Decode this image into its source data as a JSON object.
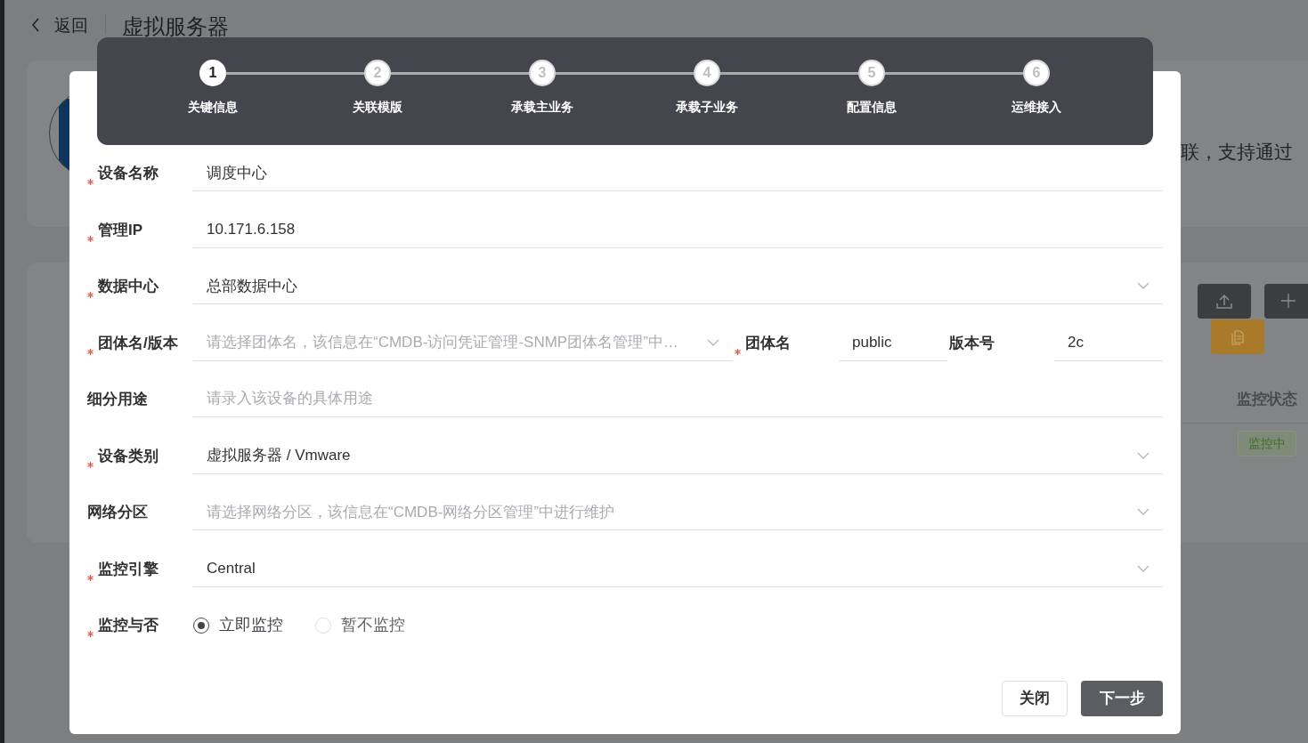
{
  "page": {
    "back": "返回",
    "title": "虚拟服务器",
    "description_fragment": "联，支持通过",
    "table_header": "监控状态",
    "status_tag": "监控中"
  },
  "steps": [
    {
      "number": "1",
      "label": "关键信息",
      "selected": true
    },
    {
      "number": "2",
      "label": "关联模版",
      "selected": false
    },
    {
      "number": "3",
      "label": "承载主业务",
      "selected": false
    },
    {
      "number": "4",
      "label": "承载子业务",
      "selected": false
    },
    {
      "number": "5",
      "label": "配置信息",
      "selected": false
    },
    {
      "number": "6",
      "label": "运维接入",
      "selected": false
    }
  ],
  "fields": [
    {
      "kind": "input",
      "label": "设备名称",
      "required": true,
      "value": "调度中心"
    },
    {
      "kind": "input",
      "label": "管理IP",
      "required": true,
      "value": "10.171.6.158"
    },
    {
      "kind": "select",
      "label": "数据中心",
      "required": true,
      "value": "总部数据中心"
    },
    {
      "kind": "group",
      "label": "团体名/版本",
      "required": true,
      "placeholder": "请选择团体名，该信息在“CMDB-访问凭证管理-SNMP团体名管理”中…",
      "community": {
        "label": "团体名",
        "required": true,
        "value": "public"
      },
      "version": {
        "label": "版本号",
        "required": false,
        "value": "2c"
      }
    },
    {
      "kind": "input",
      "label": "细分用途",
      "required": false,
      "placeholder": "请录入该设备的具体用途"
    },
    {
      "kind": "select",
      "label": "设备类别",
      "required": true,
      "value": "虚拟服务器 / Vmware"
    },
    {
      "kind": "select",
      "label": "网络分区",
      "required": false,
      "placeholder": "请选择网络分区，该信息在“CMDB-网络分区管理”中进行维护"
    },
    {
      "kind": "select",
      "label": "监控引擎",
      "required": true,
      "value": "Central"
    },
    {
      "kind": "radio",
      "label": "监控与否",
      "required": true,
      "options": [
        {
          "label": "立即监控",
          "selected": true
        },
        {
          "label": "暂不监控",
          "selected": false
        }
      ]
    }
  ],
  "buttons": [
    {
      "label": "关闭",
      "kind": "secondary"
    },
    {
      "label": "下一步",
      "kind": "primary"
    }
  ]
}
